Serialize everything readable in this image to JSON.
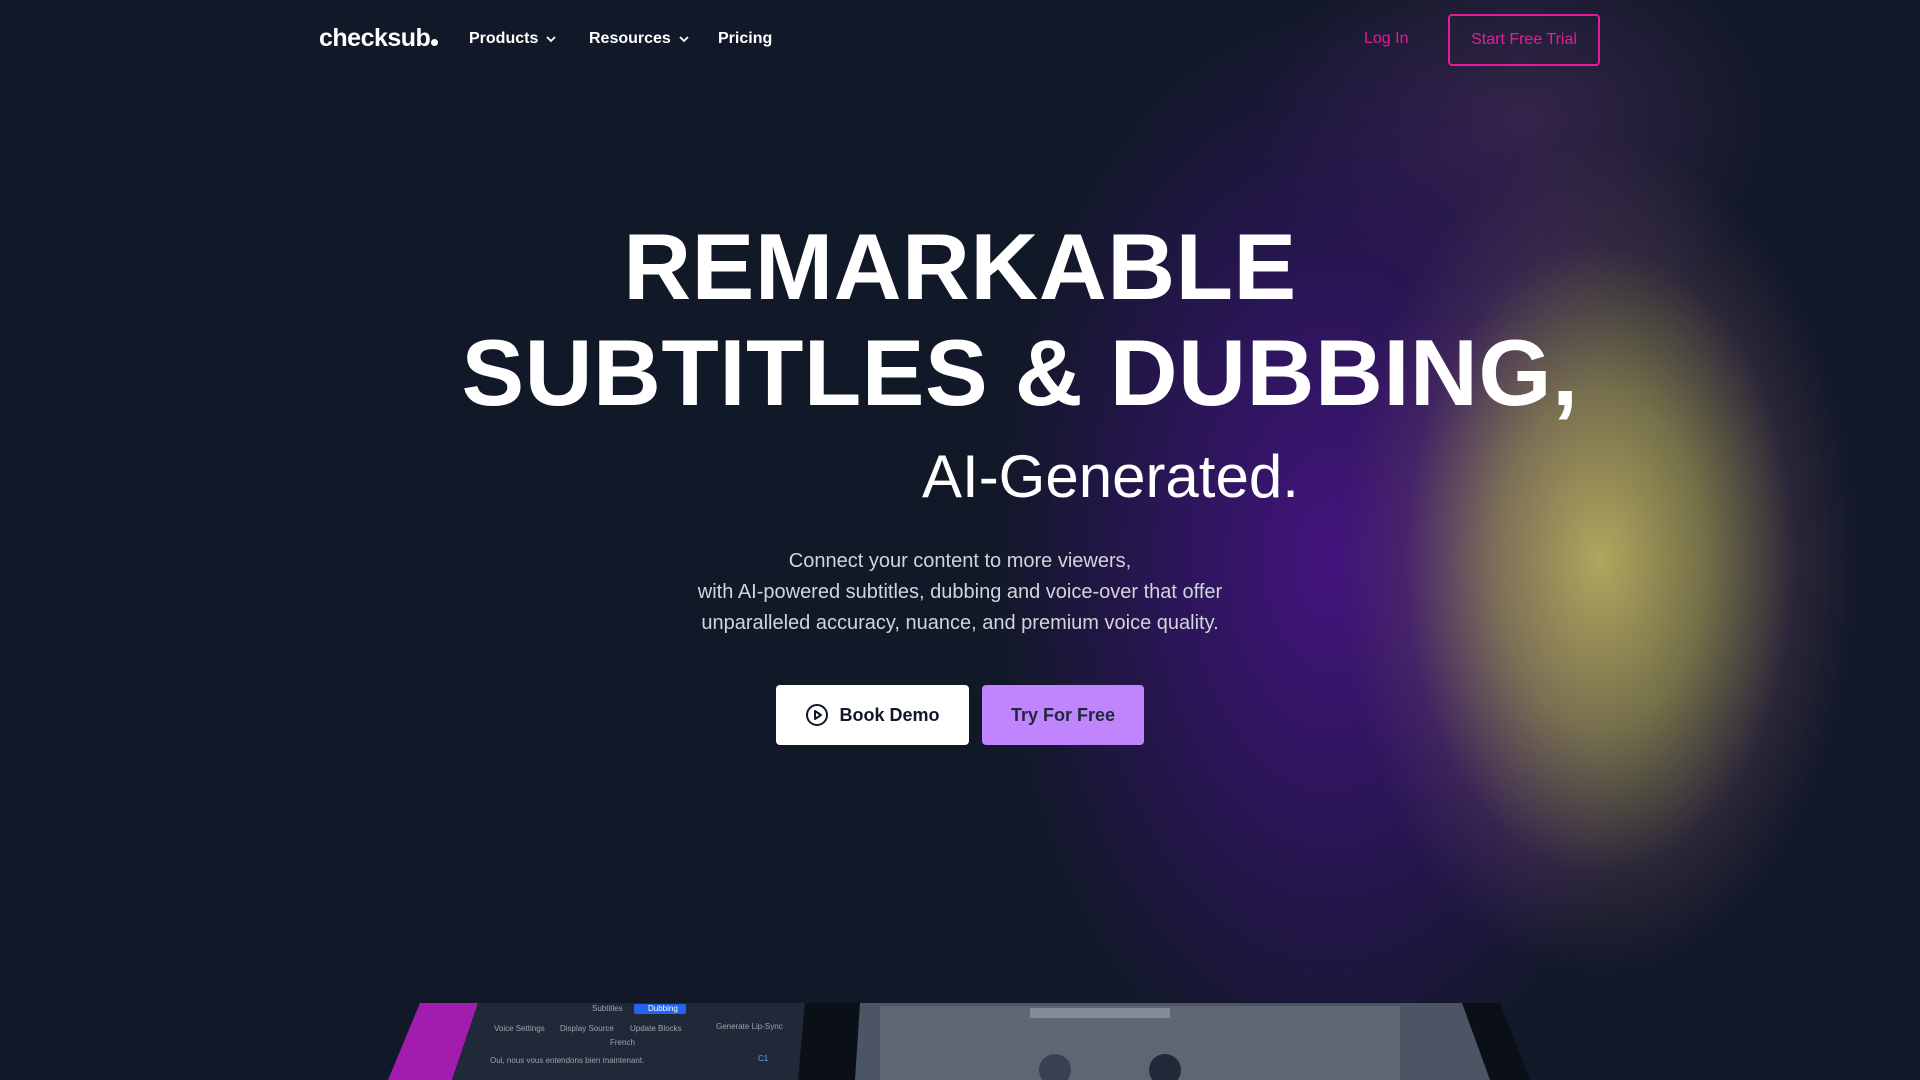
{
  "nav": {
    "logo": "checksub",
    "products": "Products",
    "resources": "Resources",
    "pricing": "Pricing",
    "login": "Log In",
    "trial": "Start Free Trial"
  },
  "hero": {
    "line1": "REMARKABLE",
    "line2": "SUBTITLES & DUBBING,",
    "line3": "AI-Generated.",
    "sub1": "Connect your content to more viewers,",
    "sub2": "with AI-powered subtitles, dubbing and voice-over that offer",
    "sub3": "unparalleled accuracy, nuance, and premium voice quality.",
    "demo_label": "Book Demo",
    "free_label": "Try For Free"
  },
  "preview": {
    "tab_subtitles": "Subtitles",
    "tab_dubbing": "Dubbing",
    "voice_settings": "Voice Settings",
    "display_source": "Display Source",
    "update_blocks": "Update Blocks",
    "generate_lipsync": "Generate Lip-Sync",
    "language": "French",
    "line": "Oui, nous vous entendons bien maintenant.",
    "speaker": "C1"
  },
  "colors": {
    "background": "#111827",
    "accent_pink": "#e11d9a",
    "accent_purple": "#c084fc"
  }
}
